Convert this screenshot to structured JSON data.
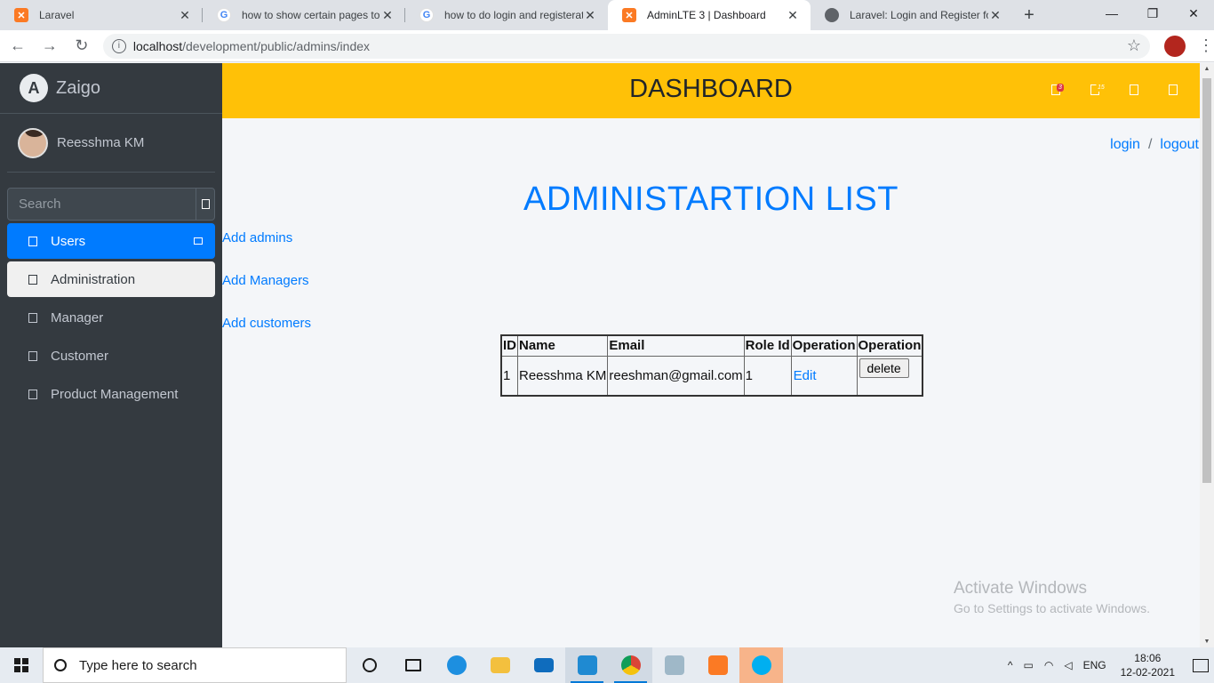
{
  "browser": {
    "tabs": [
      {
        "title": "Laravel",
        "icon": "xampp-icon",
        "active": false
      },
      {
        "title": "how to show certain pages to u",
        "icon": "google-icon",
        "active": false
      },
      {
        "title": "how to do login and registerati",
        "icon": "google-icon",
        "active": false
      },
      {
        "title": "AdminLTE 3 | Dashboard",
        "icon": "xampp-icon",
        "active": true
      },
      {
        "title": "Laravel: Login and Register for",
        "icon": "globe-icon",
        "active": false
      }
    ],
    "url_host": "localhost",
    "url_path": "/development/public/admins/index"
  },
  "sidebar": {
    "brand": "Zaigo",
    "user_name": "Reesshma KM",
    "search_placeholder": "Search",
    "items": [
      {
        "label": "Users"
      },
      {
        "label": "Administration"
      },
      {
        "label": "Manager"
      },
      {
        "label": "Customer"
      },
      {
        "label": "Product Management"
      }
    ]
  },
  "header": {
    "title": "DASHBOARD",
    "badges": {
      "messages": "3",
      "notifications": "15"
    }
  },
  "content": {
    "login_label": "login",
    "slash": "/",
    "logout_label": "logout",
    "page_title": "ADMINISTARTION LIST",
    "links": {
      "add_admins": "Add admins",
      "add_managers": "Add Managers",
      "add_customers": "Add customers"
    },
    "table": {
      "headers": [
        "ID",
        "Name",
        "Email",
        "Role Id",
        "Operation",
        "Operation"
      ],
      "rows": [
        {
          "id": "1",
          "name": "Reesshma KM",
          "email": "reeshman@gmail.com",
          "role_id": "1",
          "edit": "Edit",
          "delete": "delete"
        }
      ]
    },
    "watermark": {
      "line1": "Activate Windows",
      "line2": "Go to Settings to activate Windows."
    }
  },
  "taskbar": {
    "search_placeholder": "Type here to search",
    "language": "ENG",
    "time": "18:06",
    "date": "12-02-2021"
  },
  "colors": {
    "header_bg": "#ffc107",
    "sidebar_bg": "#343a40",
    "accent": "#007bff"
  }
}
